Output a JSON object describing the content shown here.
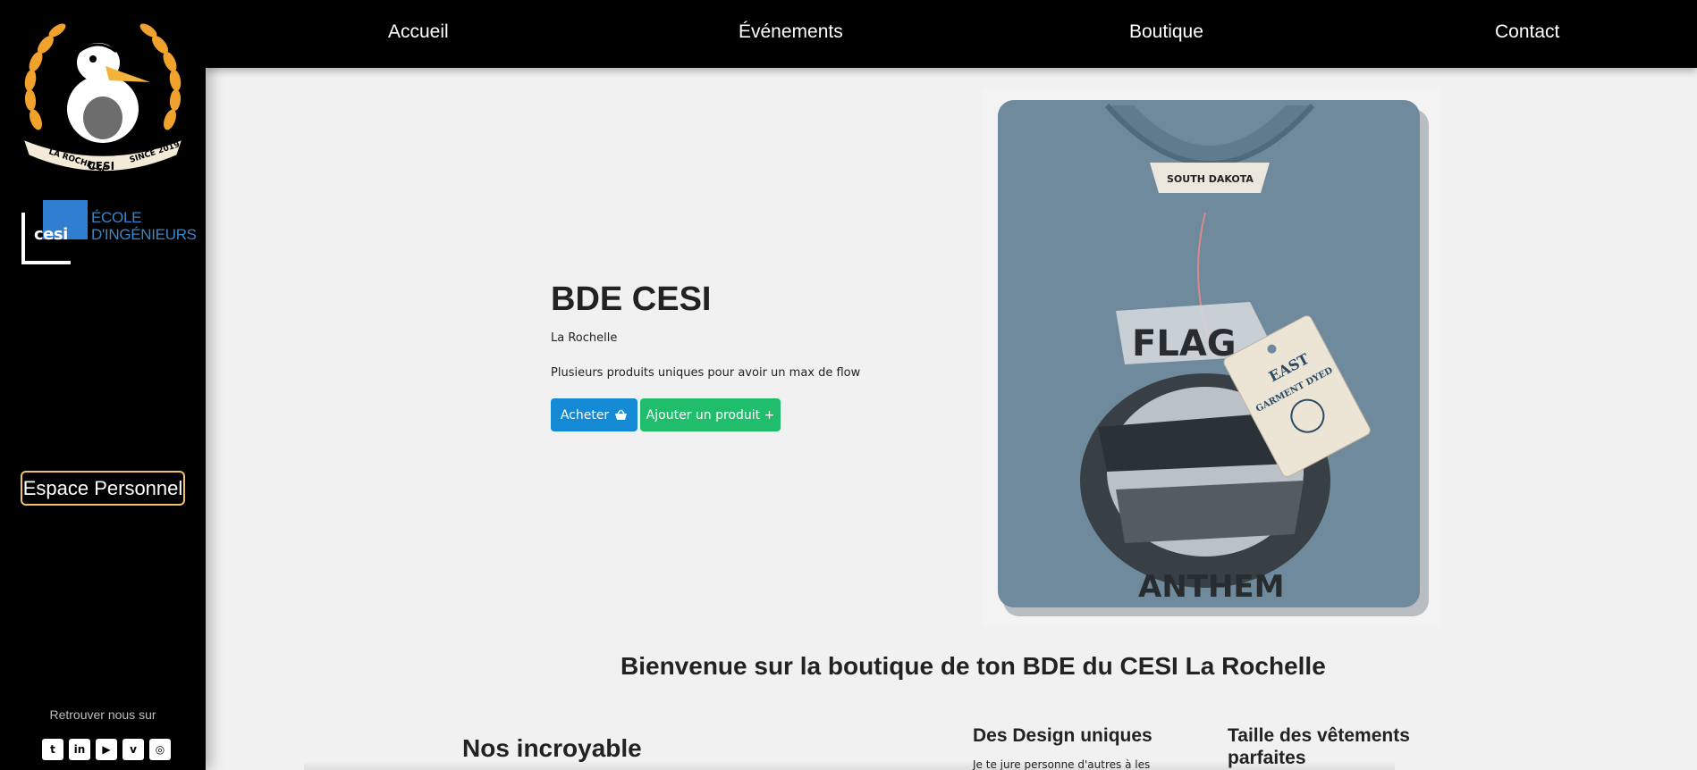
{
  "sidebar": {
    "bde_logo": {
      "top_text": "LA ROCHELLE",
      "right_text": "SINCE 2019",
      "bottom_text": "CESI"
    },
    "school_logo": {
      "word": "cesi",
      "line1": "ÉCOLE",
      "line2": "D'INGÉNIEURS"
    },
    "espace_personnel": "Espace Personnel",
    "follow_label": "Retrouver nous sur",
    "socials": [
      {
        "icon": "twitter-icon",
        "glyph": "t"
      },
      {
        "icon": "linkedin-icon",
        "glyph": "in"
      },
      {
        "icon": "youtube-icon",
        "glyph": "▶"
      },
      {
        "icon": "viadeo-icon",
        "glyph": "v"
      },
      {
        "icon": "instagram-icon",
        "glyph": "◎"
      }
    ]
  },
  "nav": {
    "home": "Accueil",
    "events": "Événements",
    "shop": "Boutique",
    "contact": "Contact"
  },
  "hero": {
    "title": "BDE CESI",
    "subtitle": "La Rochelle",
    "text": "Plusieurs produits uniques pour avoir un max de flow",
    "buy_label": "Acheter",
    "add_label": "Ajouter un produit +"
  },
  "shirt": {
    "collar_label": "SOUTH DAKOTA",
    "print_top": "FLAG",
    "print_bottom": "ANTHEM",
    "tag_top": "EAST",
    "tag_bottom": "GARMENT DYED"
  },
  "content": {
    "welcome": "Bienvenue sur la boutique de ton BDE du CESI La Rochelle",
    "feature_main": "Nos incroyable",
    "feature1_title": "Des Design uniques",
    "feature1_text": "Je te jure personne d'autres à les",
    "feature2_title": "Taille des vêtements parfaites"
  },
  "colors": {
    "buy_button": "#1489d4",
    "add_button": "#1fbd6c",
    "espace_border": "#f3c16a",
    "shirt": "#6e8a9c"
  }
}
